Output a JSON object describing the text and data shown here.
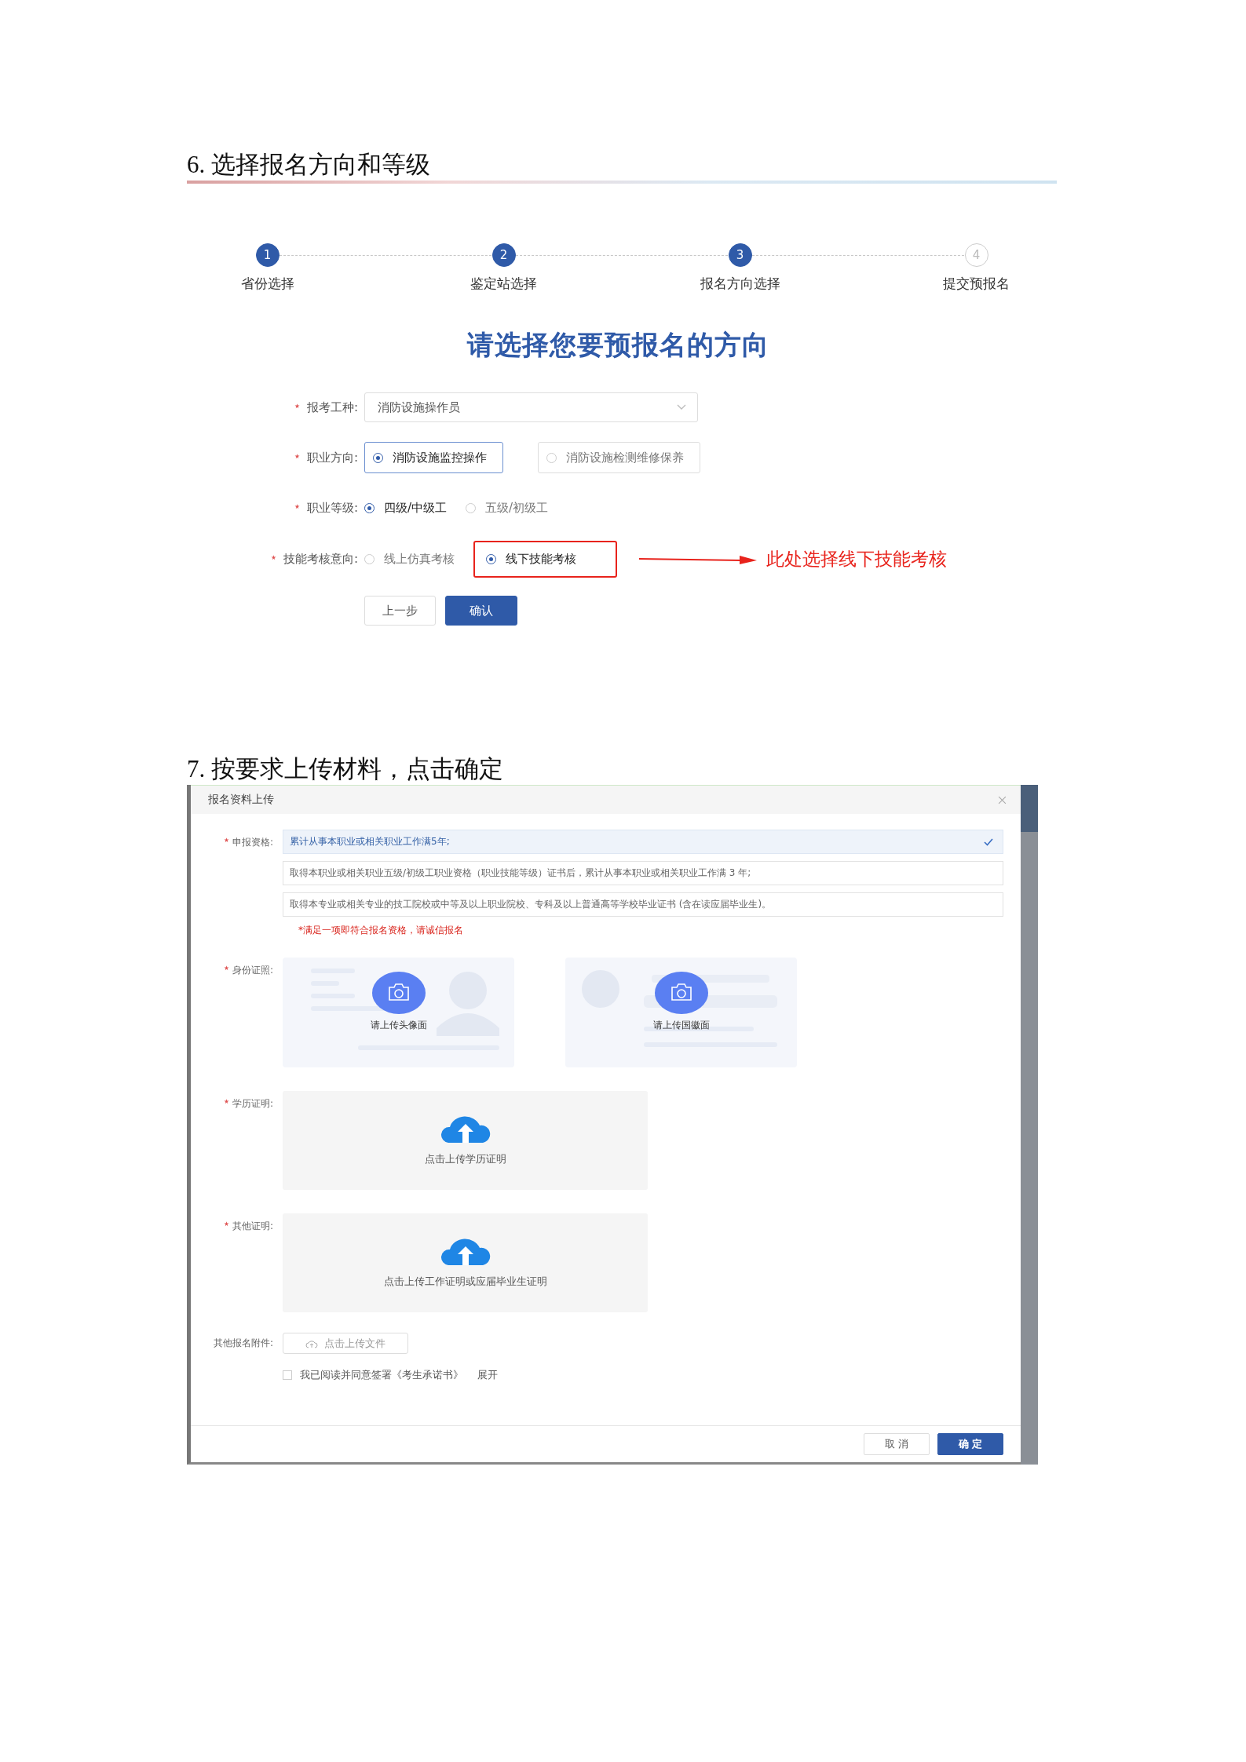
{
  "step6": {
    "heading": "6. 选择报名方向和等级",
    "steps": [
      {
        "number": "1",
        "label": "省份选择",
        "completed": true
      },
      {
        "number": "2",
        "label": "鉴定站选择",
        "completed": true
      },
      {
        "number": "3",
        "label": "报名方向选择",
        "completed": true
      },
      {
        "number": "4",
        "label": "提交预报名",
        "completed": false
      }
    ],
    "title": "请选择您要预报名的方向",
    "fields": [
      {
        "kind": "select",
        "label": "报考工种:",
        "required": true,
        "value": "消防设施操作员"
      },
      {
        "kind": "radio_boxes",
        "label": "职业方向:",
        "required": true,
        "options": [
          {
            "label": "消防设施监控操作",
            "selected": true
          },
          {
            "label": "消防设施检测维修保养",
            "selected": false
          }
        ]
      },
      {
        "kind": "radio",
        "label": "职业等级:",
        "required": true,
        "options": [
          {
            "label": "四级/中级工",
            "selected": true,
            "highlighted": false
          },
          {
            "label": "五级/初级工",
            "selected": false,
            "highlighted": false
          }
        ]
      },
      {
        "kind": "radio",
        "label": "技能考核意向:",
        "required": true,
        "options": [
          {
            "label": "线上仿真考核",
            "selected": false,
            "highlighted": false
          },
          {
            "label": "线下技能考核",
            "selected": true,
            "highlighted": true
          }
        ]
      }
    ],
    "annotation": "此处选择线下技能考核",
    "buttons": [
      {
        "label": "上一步",
        "kind": "secondary"
      },
      {
        "label": "确认",
        "kind": "primary"
      }
    ]
  },
  "step7": {
    "heading": "7.  按要求上传材料，点击确定",
    "modal": {
      "title": "报名资料上传",
      "qualification": {
        "label": "申报资格:",
        "required": true,
        "options": [
          {
            "text": "累计从事本职业或相关职业工作满5年;",
            "selected": true
          },
          {
            "text": "取得本职业或相关职业五级/初级工职业资格（职业技能等级）证书后，累计从事本职业或相关职业工作满 3 年;",
            "selected": false
          },
          {
            "text": "取得本专业或相关专业的技工院校或中等及以上职业院校、专科及以上普通高等学校毕业证书 (含在读应届毕业生)。",
            "selected": false
          }
        ],
        "note": "*满足一项即符合报名资格，请诚信报名"
      },
      "id_photos": {
        "label": "身份证照:",
        "required": true,
        "slots": [
          {
            "kind": "portrait",
            "caption": "请上传头像面"
          },
          {
            "kind": "emblem",
            "caption": "请上传国徽面"
          }
        ]
      },
      "uploads": [
        {
          "label": "学历证明:",
          "required": true,
          "caption": "点击上传学历证明"
        },
        {
          "label": "其他证明:",
          "required": true,
          "caption": "点击上传工作证明或应届毕业生证明"
        }
      ],
      "attachment": {
        "label": "其他报名附件:",
        "required": false,
        "button": "点击上传文件"
      },
      "agreement": {
        "checked": false,
        "text": "我已阅读并同意签署《考生承诺书》",
        "link": "展开"
      },
      "buttons": [
        {
          "label": "取 消",
          "kind": "secondary"
        },
        {
          "label": "确 定",
          "kind": "primary"
        }
      ]
    }
  }
}
